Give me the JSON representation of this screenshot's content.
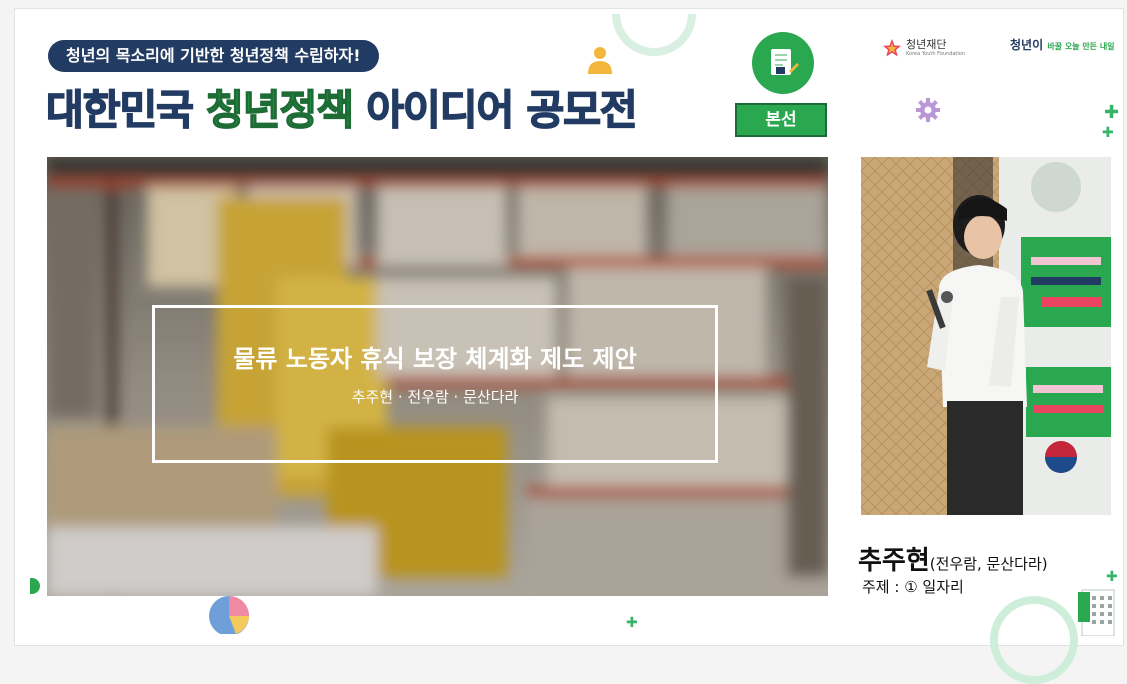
{
  "header": {
    "tagline": "청년의 목소리에 기반한 청년정책 수립하자!",
    "title_part1": "대한민국 ",
    "title_part2": "청년정책",
    "title_part3": " 아이디어 공모전",
    "round_badge": "본선"
  },
  "logos": {
    "foundation_name": "청년재단",
    "foundation_sub": "Korea Youth Foundation",
    "campaign_text": "청년이",
    "campaign_sub": "바꿀 오늘 만든 내일"
  },
  "presentation": {
    "title": "물류 노동자 휴식 보장 체계화 제도 제안",
    "authors": "추주현 · 전우람 · 문산다라"
  },
  "speaker": {
    "name": "추주현",
    "co_presenters": "(전우람, 문산다라)",
    "topic": "주제 : ① 일자리"
  },
  "colors": {
    "navy": "#223b62",
    "green": "#2aa84f",
    "dark_green": "#1d6b35"
  },
  "icons": [
    "person-icon",
    "document-icon",
    "star-logo-icon",
    "gear-icon",
    "plus-icon",
    "pie-chart-icon",
    "building-icon"
  ]
}
